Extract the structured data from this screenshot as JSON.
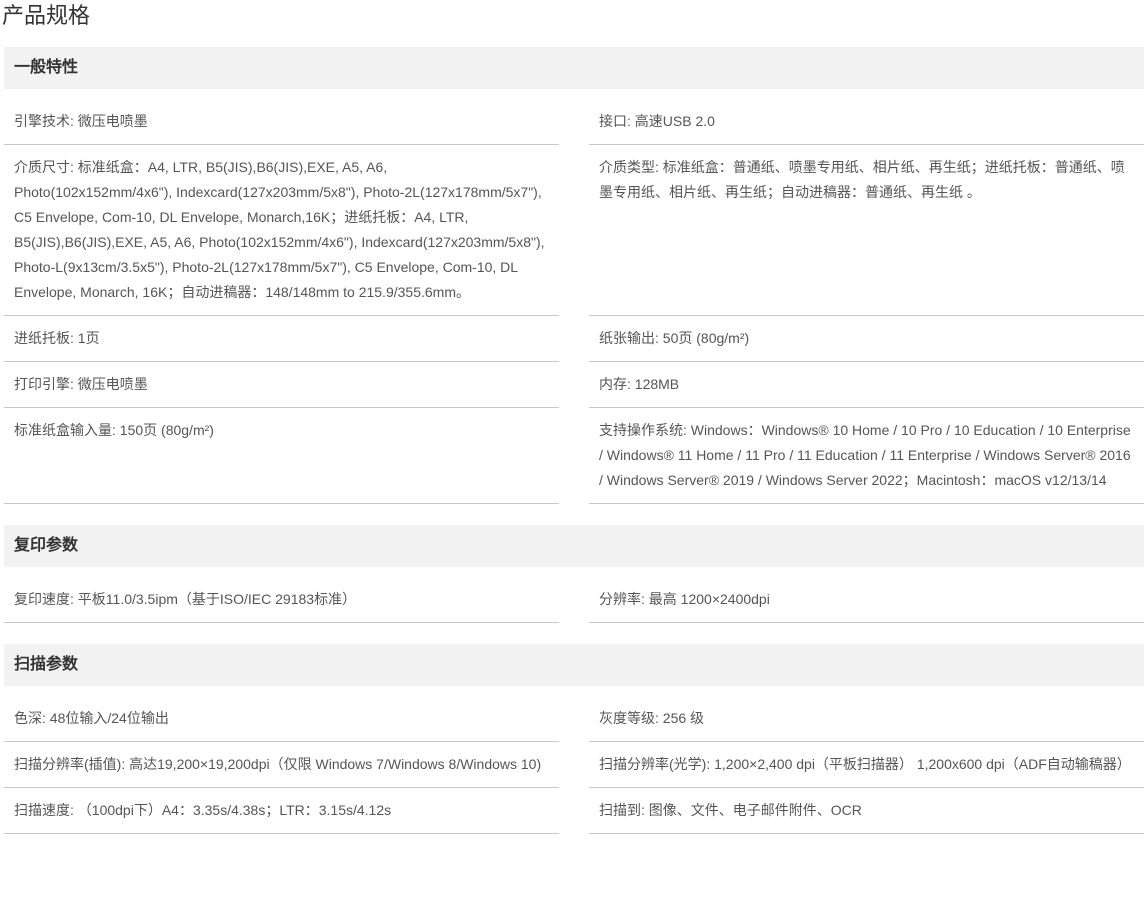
{
  "page_title": "产品规格",
  "sections": [
    {
      "title": "一般特性",
      "rows": [
        [
          {
            "label": "引擎技术:",
            "value": "微压电喷墨"
          },
          {
            "label": "接口:",
            "value": "高速USB 2.0"
          }
        ],
        [
          {
            "label": "介质尺寸:",
            "value": "标准纸盒：A4, LTR, B5(JIS),B6(JIS),EXE, A5, A6, Photo(102x152mm/4x6\"), Indexcard(127x203mm/5x8\"), Photo-2L(127x178mm/5x7\"), C5 Envelope, Com-10, DL Envelope, Monarch,16K；进纸托板：A4, LTR, B5(JIS),B6(JIS),EXE, A5, A6, Photo(102x152mm/4x6\"), Indexcard(127x203mm/5x8\"), Photo-L(9x13cm/3.5x5\"), Photo-2L(127x178mm/5x7\"), C5 Envelope, Com-10, DL Envelope, Monarch, 16K；自动进稿器：148/148mm to 215.9/355.6mm。"
          },
          {
            "label": "介质类型:",
            "value": "标准纸盒：普通纸、喷墨专用纸、相片纸、再生纸；进纸托板：普通纸、喷墨专用纸、相片纸、再生纸；自动进稿器：普通纸、再生纸 。"
          }
        ],
        [
          {
            "label": "进纸托板:",
            "value": "1页"
          },
          {
            "label": "纸张输出:",
            "value": "50页 (80g/m²)"
          }
        ],
        [
          {
            "label": "打印引擎:",
            "value": "微压电喷墨"
          },
          {
            "label": "内存:",
            "value": "128MB"
          }
        ],
        [
          {
            "label": "标准纸盒输入量:",
            "value": "150页 (80g/m²)"
          },
          {
            "label": "支持操作系统:",
            "value": "Windows：Windows® 10 Home / 10 Pro / 10 Education / 10 Enterprise / Windows® 11 Home / 11 Pro / 11 Education / 11 Enterprise / Windows Server® 2016 / Windows Server® 2019 / Windows Server 2022；Macintosh：macOS v12/13/14"
          }
        ]
      ]
    },
    {
      "title": "复印参数",
      "rows": [
        [
          {
            "label": "复印速度:",
            "value": "平板11.0/3.5ipm（基于ISO/IEC 29183标准）"
          },
          {
            "label": "分辨率:",
            "value": "最高 1200×2400dpi"
          }
        ]
      ]
    },
    {
      "title": "扫描参数",
      "rows": [
        [
          {
            "label": "色深:",
            "value": "48位输入/24位输出"
          },
          {
            "label": "灰度等级:",
            "value": "256 级"
          }
        ],
        [
          {
            "label": "扫描分辨率(插值):",
            "value": "高达19,200×19,200dpi（仅限 Windows 7/Windows 8/Windows 10)"
          },
          {
            "label": "扫描分辨率(光学):",
            "value": "1,200×2,400 dpi（平板扫描器） 1,200x600 dpi（ADF自动输稿器）"
          }
        ],
        [
          {
            "label": "扫描速度:",
            "value": "（100dpi下）A4：3.35s/4.38s；LTR：3.15s/4.12s"
          },
          {
            "label": "扫描到:",
            "value": "图像、文件、电子邮件附件、OCR"
          }
        ]
      ]
    }
  ]
}
